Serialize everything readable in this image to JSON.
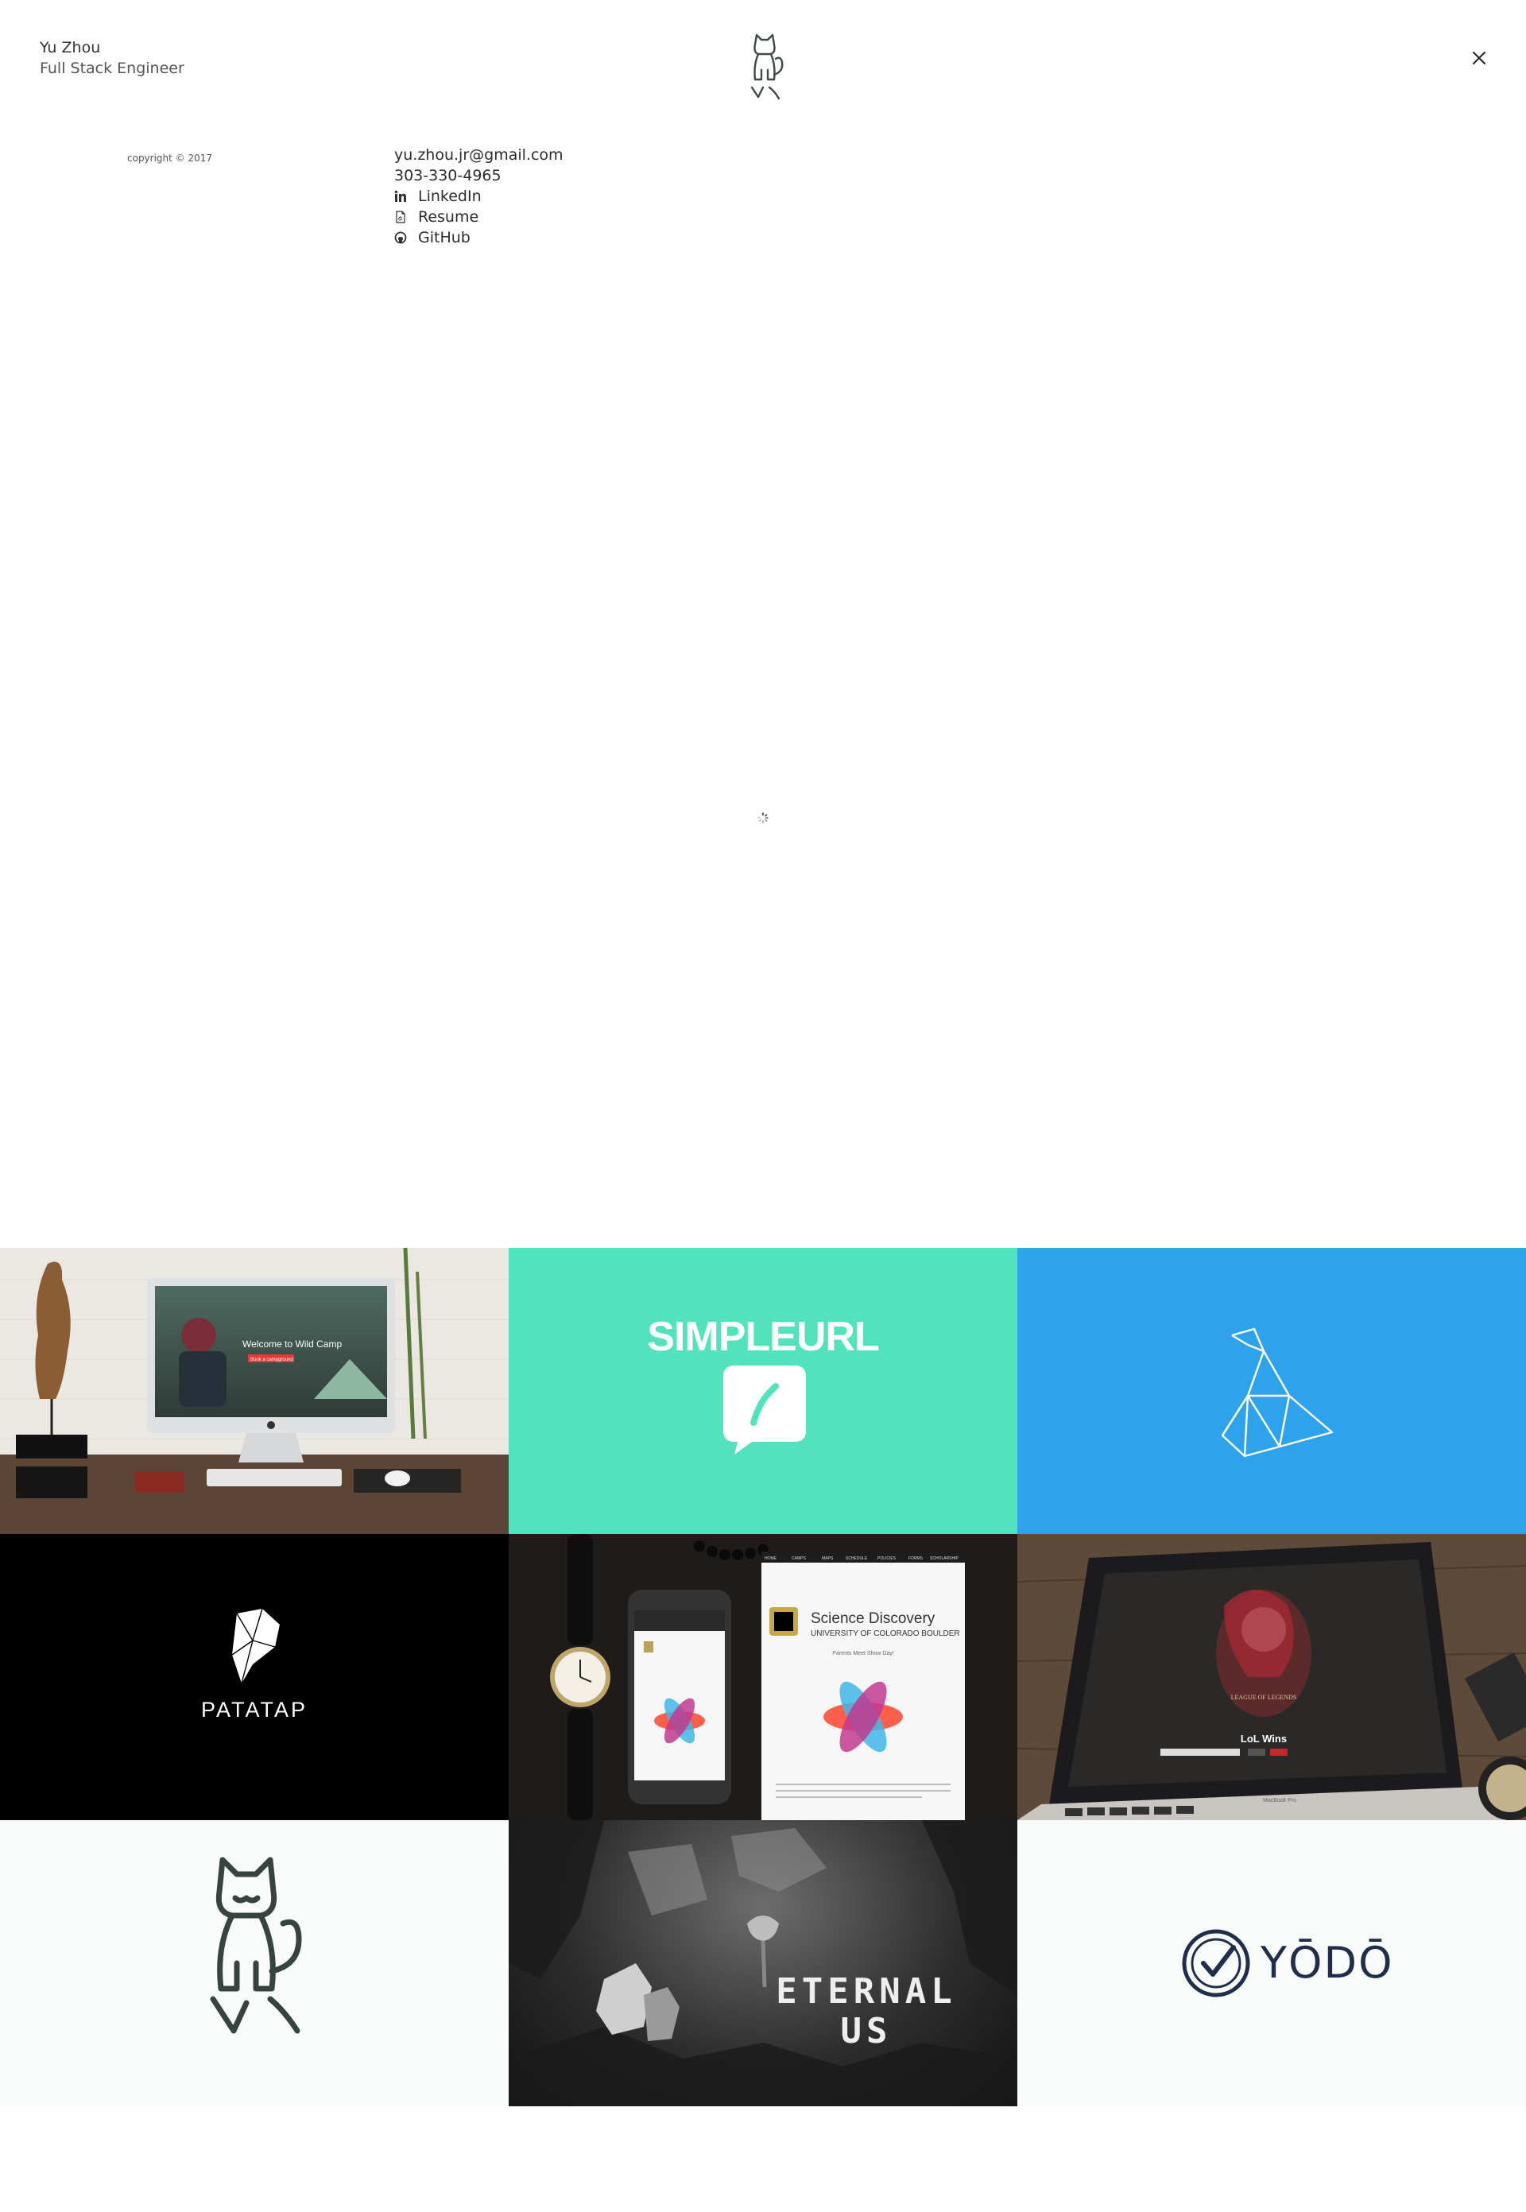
{
  "header": {
    "name": "Yu Zhou",
    "title": "Full Stack Engineer"
  },
  "sidebar": {
    "copyright": "copyright © 2017"
  },
  "contact": {
    "email": "yu.zhou.jr@gmail.com",
    "phone": "303-330-4965",
    "links": [
      {
        "label": "LinkedIn",
        "icon": "linkedin-icon"
      },
      {
        "label": "Resume",
        "icon": "document-icon"
      },
      {
        "label": "GitHub",
        "icon": "github-icon"
      }
    ]
  },
  "projects": [
    {
      "name": "website-mockup",
      "screen_text": "Welcome to Wild Camp",
      "screen_button": "Book a campground"
    },
    {
      "name": "simpleurl",
      "label": "SIMPLEURL"
    },
    {
      "name": "origami-bird"
    },
    {
      "name": "patatap",
      "label": "PATATAP"
    },
    {
      "name": "science-discovery",
      "title": "Science Discovery",
      "subtitle": "UNIVERSITY OF COLORADO BOULDER",
      "tagline": "Parents Meet Show Day!",
      "nav": [
        "HOME",
        "CAMPS",
        "MAPS",
        "SCHEDULE",
        "POLICIES",
        "FORMS",
        "SCHOLARSHIP"
      ]
    },
    {
      "name": "lol-wins",
      "label": "LoL Wins",
      "game": "LEAGUE OF LEGENDS",
      "device": "MacBook Pro"
    },
    {
      "name": "cat-logo"
    },
    {
      "name": "eternal-us",
      "label_line1": "ETERNAL",
      "label_line2": "US"
    },
    {
      "name": "yodo",
      "label": "YŌDŌ"
    }
  ],
  "colors": {
    "simpleurl": "#52e3bc",
    "origami": "#2ea3ec",
    "yodo": "#1f2e4a",
    "cat": "#36443f"
  }
}
